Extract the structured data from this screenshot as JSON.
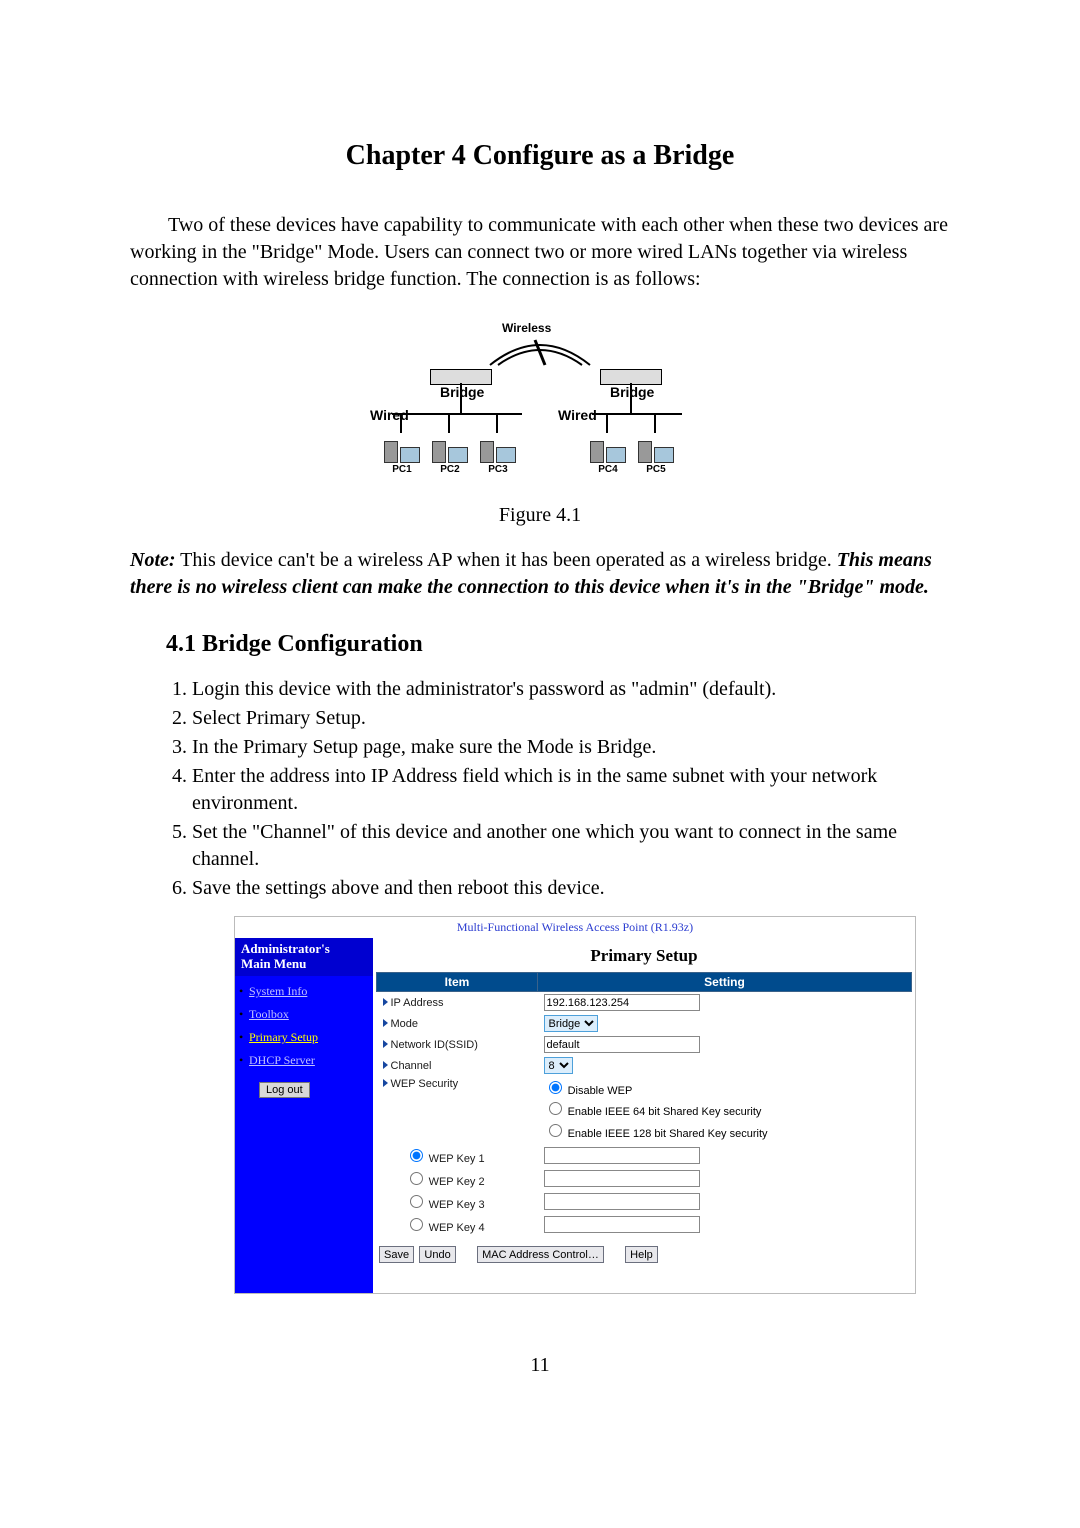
{
  "chapter_title": "Chapter 4 Configure as a Bridge",
  "intro_paragraph": "Two of these devices have capability to communicate with each other when these two devices are working in the \"Bridge\" Mode. Users can connect two or more wired LANs together via wireless connection with wireless bridge function. The connection is as follows:",
  "figure": {
    "caption": "Figure 4.1",
    "labels": {
      "wireless": "Wireless",
      "bridge": "Bridge",
      "wired": "Wired",
      "pcs": [
        "PC1",
        "PC2",
        "PC3",
        "PC4",
        "PC5"
      ]
    }
  },
  "note": {
    "label": "Note:",
    "plain": " This device can't be a wireless AP when it has been operated as a wireless bridge. ",
    "em": "This means there is no wireless client can make the connection to this device when it's in the \"Bridge\" mode."
  },
  "section_heading": "4.1 Bridge Configuration",
  "steps": [
    "Login this device with the administrator's password as \"admin\" (default).",
    "Select Primary Setup.",
    "In the Primary Setup page, make sure the Mode is Bridge.",
    "Enter the address into IP Address field which is in the same subnet with your network environment.",
    "Set the \"Channel\" of this device and another one which you want to connect in the same channel.",
    "Save the settings above and then reboot this device."
  ],
  "screenshot": {
    "product_title": "Multi-Functional Wireless Access Point (R1.93z)",
    "sidebar": {
      "header_line1": "Administrator's",
      "header_line2": "Main Menu",
      "items": [
        "System Info",
        "Toolbox",
        "Primary Setup",
        "DHCP Server"
      ],
      "active_index": 2,
      "logout_label": "Log out"
    },
    "main": {
      "title": "Primary Setup",
      "headers": {
        "item": "Item",
        "setting": "Setting"
      },
      "rows": {
        "ip_address": {
          "label": "IP Address",
          "value": "192.168.123.254"
        },
        "mode": {
          "label": "Mode",
          "value": "Bridge"
        },
        "network_id": {
          "label": "Network ID(SSID)",
          "value": "default"
        },
        "channel": {
          "label": "Channel",
          "value": "8"
        },
        "wep_security": {
          "label": "WEP Security",
          "options": [
            "Disable WEP",
            "Enable IEEE 64 bit Shared Key security",
            "Enable IEEE 128 bit Shared Key security"
          ],
          "selected_index": 0
        },
        "wep_keys": {
          "labels": [
            "WEP Key 1",
            "WEP Key 2",
            "WEP Key 3",
            "WEP Key 4"
          ],
          "selected_index": 0,
          "values": [
            "",
            "",
            "",
            ""
          ]
        }
      },
      "buttons": {
        "save": "Save",
        "undo": "Undo",
        "mac": "MAC Address Control…",
        "help": "Help"
      }
    }
  },
  "page_number": "11"
}
